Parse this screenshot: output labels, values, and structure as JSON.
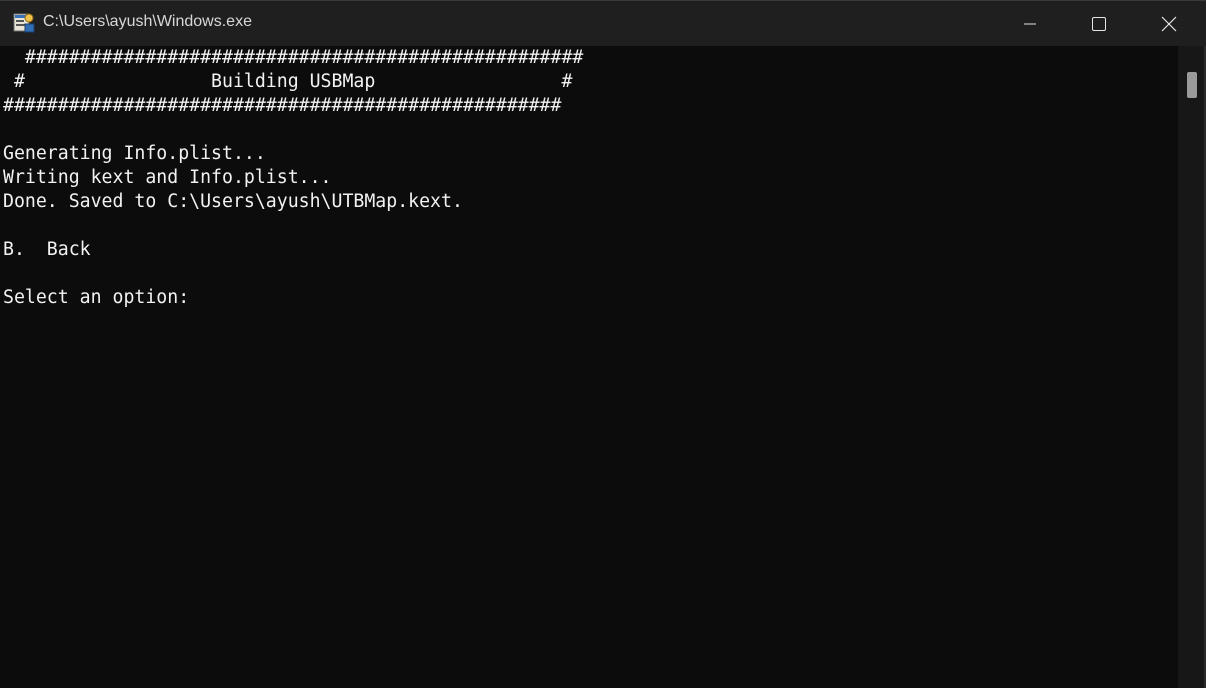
{
  "window": {
    "title": "C:\\Users\\ayush\\Windows.exe"
  },
  "console": {
    "lines": [
      "  ###################################################",
      " #                 Building USBMap                 #",
      "###################################################",
      "",
      "Generating Info.plist...",
      "Writing kext and Info.plist...",
      "Done. Saved to C:\\Users\\ayush\\UTBMap.kext.",
      "",
      "B.  Back",
      "",
      "Select an option: "
    ]
  },
  "icons": {
    "app": "console-app-icon",
    "minimize": "minimize-icon",
    "maximize": "maximize-icon",
    "close": "close-icon"
  },
  "colors": {
    "background": "#0c0c0c",
    "titlebar": "#1f1f1f",
    "text": "#f2f2f2"
  }
}
